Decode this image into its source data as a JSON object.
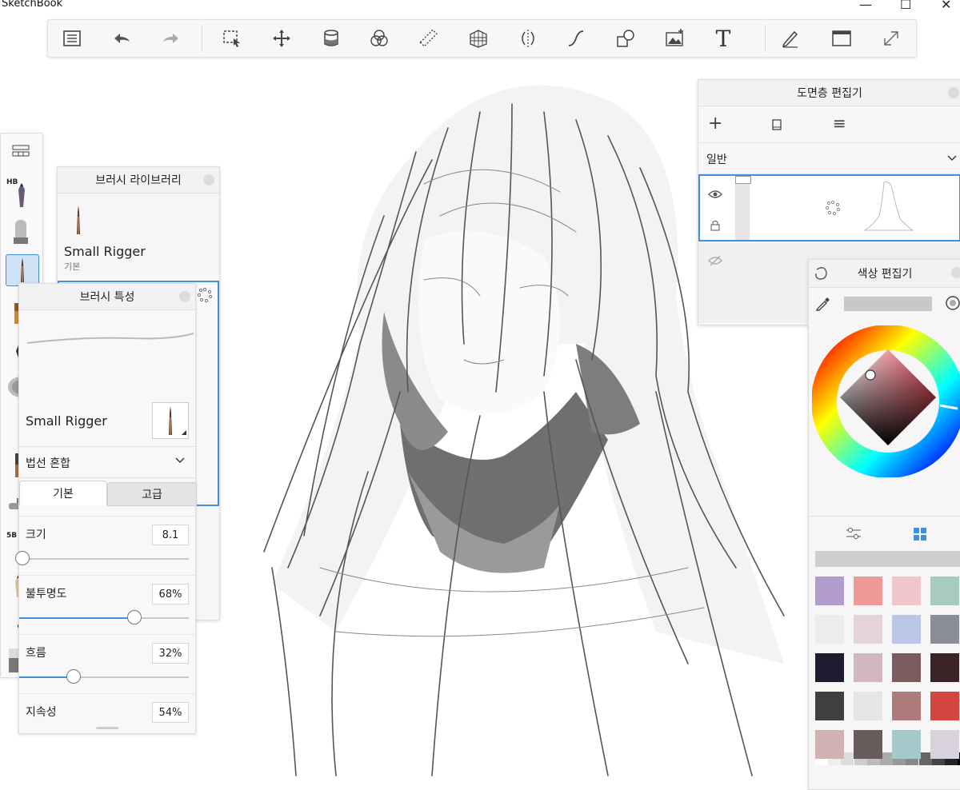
{
  "app": {
    "title": "SketchBook"
  },
  "window": {
    "minimize": "—",
    "maximize": "☐",
    "close": "✕"
  },
  "toolbar": {
    "tools": [
      "list-icon",
      "undo-icon",
      "redo-icon",
      "select-icon",
      "transform-icon",
      "fill-bucket-icon",
      "color-blend-icon",
      "ruler-icon",
      "perspective-icon",
      "symmetry-icon",
      "curve-icon",
      "shapes-icon",
      "image-import-icon",
      "text-icon",
      "pen-settings-icon",
      "fullscreen-frame-icon",
      "expand-icon"
    ],
    "text_tool": "T"
  },
  "brush_strip": {
    "top_label": "HB",
    "mid_label": "5B",
    "number": "4",
    "selected_index": 2
  },
  "brush_library": {
    "title": "브러시 라이브러리",
    "brush_name": "Small Rigger",
    "brush_category": "기본"
  },
  "brush_props": {
    "title": "브러시 특성",
    "brush_name": "Small Rigger",
    "blend_mode": "법선 혼합",
    "tabs": [
      "기본",
      "고급"
    ],
    "rows": [
      {
        "label": "크기",
        "value": "8.1",
        "fraction": 0.02
      },
      {
        "label": "불투명도",
        "value": "68%",
        "fraction": 0.68
      },
      {
        "label": "흐름",
        "value": "32%",
        "fraction": 0.32
      },
      {
        "label": "지속성",
        "value": "54%",
        "fraction": 0.54
      }
    ]
  },
  "layer_editor": {
    "title": "도면층 편집기",
    "blend_mode": "일반",
    "add": "+",
    "menu": "≡"
  },
  "color_editor": {
    "title": "색상 편집기",
    "current_color": "#c8c8c8",
    "grays": [
      "#ffffff",
      "#eeeeee",
      "#dddddd",
      "#cccccc",
      "#bbbbbb",
      "#aaaaaa",
      "#999999",
      "#888888",
      "#666666",
      "#444444",
      "#222222",
      "#000000"
    ],
    "swatches": [
      [
        "#b19ccb",
        "#ef9898",
        "#f0c6cb",
        "#a7cbc1"
      ],
      [
        "#ececec",
        "#e4d3db",
        "#bcc6e6",
        "#8b8e96"
      ],
      [
        "#211b32",
        "#d1b7c0",
        "#7a5c5e",
        "#3b2425"
      ],
      [
        "#3f3f3f",
        "#e5e5e5",
        "#ac7b7a",
        "#d2463f"
      ],
      [
        "#d3b2b2",
        "#685b5b",
        "#a5c9cb",
        "#d9d2dc"
      ]
    ]
  }
}
